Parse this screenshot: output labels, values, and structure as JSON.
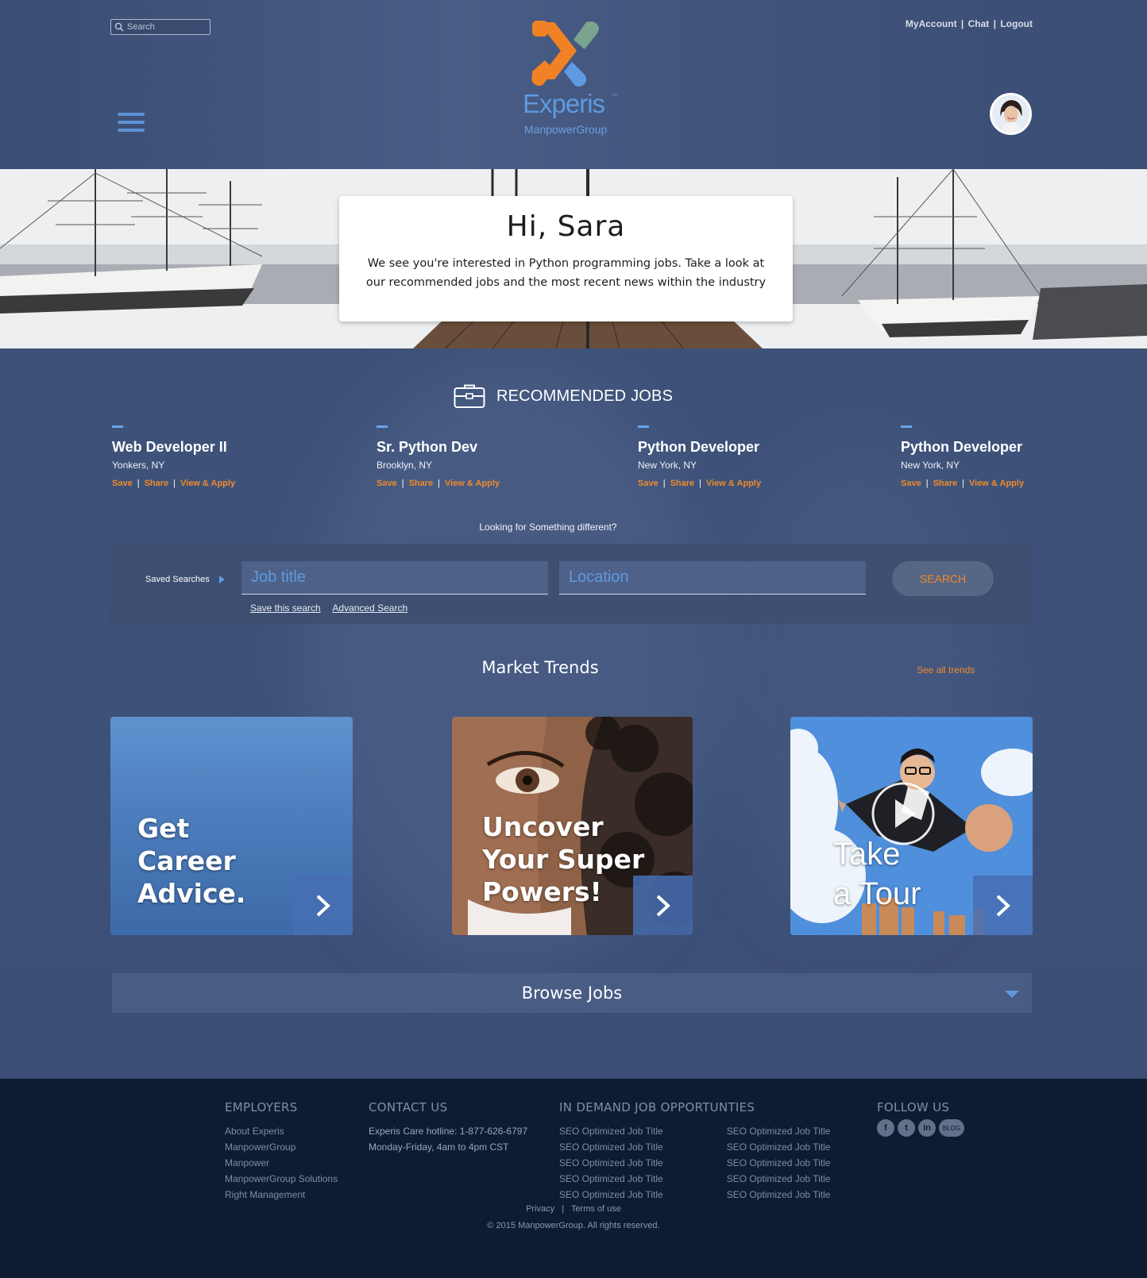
{
  "header": {
    "search_placeholder": "Search",
    "links": [
      "MyAccount",
      "Chat",
      "Logout"
    ],
    "logo_text": "Experis",
    "logo_tm": "™",
    "logo_sub": "ManpowerGroup"
  },
  "hero": {
    "greeting": "Hi, Sara",
    "message": "We see you're interested in Python programming jobs. Take a look at our recommended jobs and the most recent news within the industry"
  },
  "recommended": {
    "title": "RECOMMENDED JOBS",
    "jobs": [
      {
        "title": "Web Developer II",
        "location": "Yonkers, NY"
      },
      {
        "title": "Sr. Python Dev",
        "location": "Brooklyn, NY"
      },
      {
        "title": "Python Developer",
        "location": "New York, NY"
      },
      {
        "title": "Python Developer",
        "location": "New York, NY"
      }
    ],
    "actions": {
      "save": "Save",
      "share": "Share",
      "apply": "View & Apply",
      "sep": "|"
    }
  },
  "search": {
    "looking_text": "Looking for Something different?",
    "saved_searches": "Saved Searches",
    "job_placeholder": "Job title",
    "location_placeholder": "Location",
    "button": "SEARCH",
    "save_link": "Save this search",
    "advanced_link": "Advanced Search"
  },
  "trends": {
    "title": "Market Trends",
    "see_all": "See all trends",
    "tiles": [
      {
        "lines": [
          "Get",
          "Career",
          "Advice."
        ]
      },
      {
        "lines": [
          "Uncover",
          "Your Super",
          "Powers!"
        ]
      },
      {
        "lines": [
          "Take",
          "a Tour"
        ]
      }
    ]
  },
  "browse": {
    "label": "Browse Jobs"
  },
  "footer": {
    "employers": {
      "title": "EMPLOYERS",
      "links": [
        "About Experis",
        "ManpowerGroup",
        "Manpower",
        "ManpowerGroup Solutions",
        "Right Management"
      ]
    },
    "contact": {
      "title": "CONTACT US",
      "lines": [
        "Experis Care hotline: 1-877-626-6797",
        "Monday-Friday, 4am to 4pm CST"
      ]
    },
    "in_demand": {
      "title": "IN DEMAND JOB OPPORTUNTIES",
      "col1": [
        "SEO Optimized Job Title",
        "SEO Optimized Job Title",
        "SEO Optimized Job Title",
        "SEO Optimized Job Title",
        "SEO Optimized Job Title"
      ],
      "col2": [
        "SEO Optimized Job Title",
        "SEO Optimized Job Title",
        "SEO Optimized Job Title",
        "SEO Optimized Job Title",
        "SEO Optimized Job Title"
      ]
    },
    "follow": {
      "title": "FOLLOW US",
      "icons": [
        "f",
        "t",
        "in",
        "BLOG"
      ]
    },
    "privacy": "Privacy",
    "sep": "|",
    "terms": "Terms of use",
    "copyright": "© 2015 ManpowerGroup. All rights reserved."
  },
  "colors": {
    "accent_orange": "#f08a2c",
    "accent_blue": "#5f9ae0",
    "footer_bg": "#0f1b31"
  }
}
